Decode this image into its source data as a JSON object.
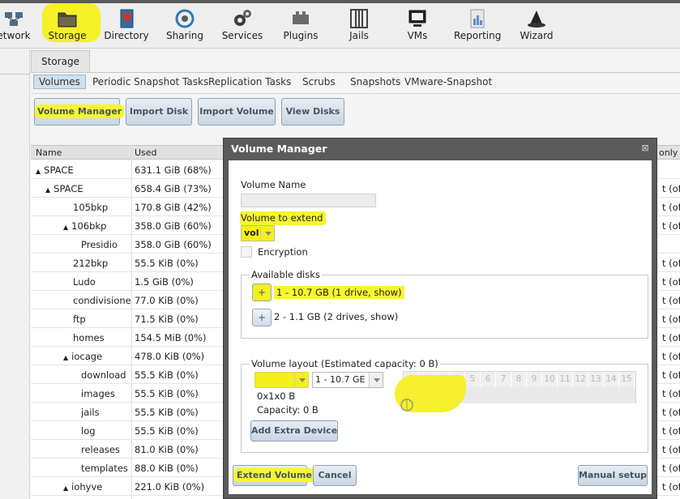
{
  "nav": {
    "items": [
      {
        "label": "etwork",
        "icon": "network-icon"
      },
      {
        "label": "Storage",
        "icon": "storage-folder-icon"
      },
      {
        "label": "Directory",
        "icon": "directory-book-icon"
      },
      {
        "label": "Sharing",
        "icon": "sharing-icon"
      },
      {
        "label": "Services",
        "icon": "services-gears-icon"
      },
      {
        "label": "Plugins",
        "icon": "plugins-icon"
      },
      {
        "label": "Jails",
        "icon": "jails-icon"
      },
      {
        "label": "VMs",
        "icon": "vms-monitor-icon"
      },
      {
        "label": "Reporting",
        "icon": "reporting-icon"
      },
      {
        "label": "Wizard",
        "icon": "wizard-hat-icon"
      }
    ]
  },
  "storage_tab": "Storage",
  "subtabs": [
    "Volumes",
    "Periodic Snapshot Tasks",
    "Replication Tasks",
    "Scrubs",
    "Snapshots",
    "VMware-Snapshot"
  ],
  "buttons": {
    "volume_manager": "Volume Manager",
    "import_disk": "Import Disk",
    "import_volume": "Import Volume",
    "view_disks": "View Disks"
  },
  "table": {
    "headers": {
      "name": "Name",
      "used": "Used",
      "readonly": "only"
    },
    "rows": [
      {
        "name": "SPACE",
        "used": "631.1 GiB (68%)",
        "right": "",
        "arrow": "▲"
      },
      {
        "name": "SPACE",
        "used": "658.4 GiB (73%)",
        "right": "t (off",
        "arrow": "▲"
      },
      {
        "name": "105bkp",
        "used": "170.8 GiB (42%)",
        "right": "t (off",
        "arrow": ""
      },
      {
        "name": "106bkp",
        "used": "358.0 GiB (60%)",
        "right": "t (off",
        "arrow": "▲"
      },
      {
        "name": "Presidio",
        "used": "358.0 GiB (60%)",
        "right": "",
        "arrow": ""
      },
      {
        "name": "212bkp",
        "used": "55.5 KiB (0%)",
        "right": "t (off",
        "arrow": ""
      },
      {
        "name": "Ludo",
        "used": "1.5 GiB (0%)",
        "right": "t (off",
        "arrow": ""
      },
      {
        "name": "condivisione",
        "used": "77.0 KiB (0%)",
        "right": "t (off",
        "arrow": ""
      },
      {
        "name": "ftp",
        "used": "71.5 KiB (0%)",
        "right": "t (off",
        "arrow": ""
      },
      {
        "name": "homes",
        "used": "154.5 MiB (0%)",
        "right": "t (off",
        "arrow": ""
      },
      {
        "name": "iocage",
        "used": "478.0 KiB (0%)",
        "right": "t (off",
        "arrow": "▲"
      },
      {
        "name": "download",
        "used": "55.5 KiB (0%)",
        "right": "t (off",
        "arrow": ""
      },
      {
        "name": "images",
        "used": "55.5 KiB (0%)",
        "right": "t (off",
        "arrow": ""
      },
      {
        "name": "jails",
        "used": "55.5 KiB (0%)",
        "right": "t (off",
        "arrow": ""
      },
      {
        "name": "log",
        "used": "55.5 KiB (0%)",
        "right": "t (off",
        "arrow": ""
      },
      {
        "name": "releases",
        "used": "81.0 KiB (0%)",
        "right": "t (off",
        "arrow": ""
      },
      {
        "name": "templates",
        "used": "88.0 KiB (0%)",
        "right": "t (off",
        "arrow": ""
      },
      {
        "name": "iohyve",
        "used": "221.0 KiB (0%)",
        "right": "t (off",
        "arrow": "▲"
      }
    ]
  },
  "modal": {
    "title": "Volume Manager",
    "close_glyph": "⊠",
    "volume_name_label": "Volume Name",
    "volume_name_value": "",
    "volume_to_extend_label": "Volume to extend",
    "volume_to_extend_value": "vol",
    "encryption_label": "Encryption",
    "available_disks_label": "Available disks",
    "disks": [
      {
        "plus": "+",
        "label": "1 - 10.7 GB (1 drive, show)"
      },
      {
        "plus": "+",
        "label": "2 - 1.1 GB (2 drives, show)"
      }
    ],
    "layout_label": "Volume layout (Estimated capacity: 0 B)",
    "layout_type_value": "",
    "layout_disk_value": "1 - 10.7 GE",
    "geometry": "0x1x0 B",
    "capacity": "Capacity: 0 B",
    "slots": [
      "1",
      "2",
      "3",
      "4",
      "5",
      "6",
      "7",
      "8",
      "9",
      "10",
      "11",
      "12",
      "13",
      "14",
      "15"
    ],
    "add_extra_device": "Add Extra Device",
    "extend_volume": "Extend Volume",
    "cancel": "Cancel",
    "manual_setup": "Manual setup"
  },
  "colors": {
    "highlight": "#f5ef1c",
    "button_text": "#445566",
    "titlebar": "#5c5c5c"
  }
}
